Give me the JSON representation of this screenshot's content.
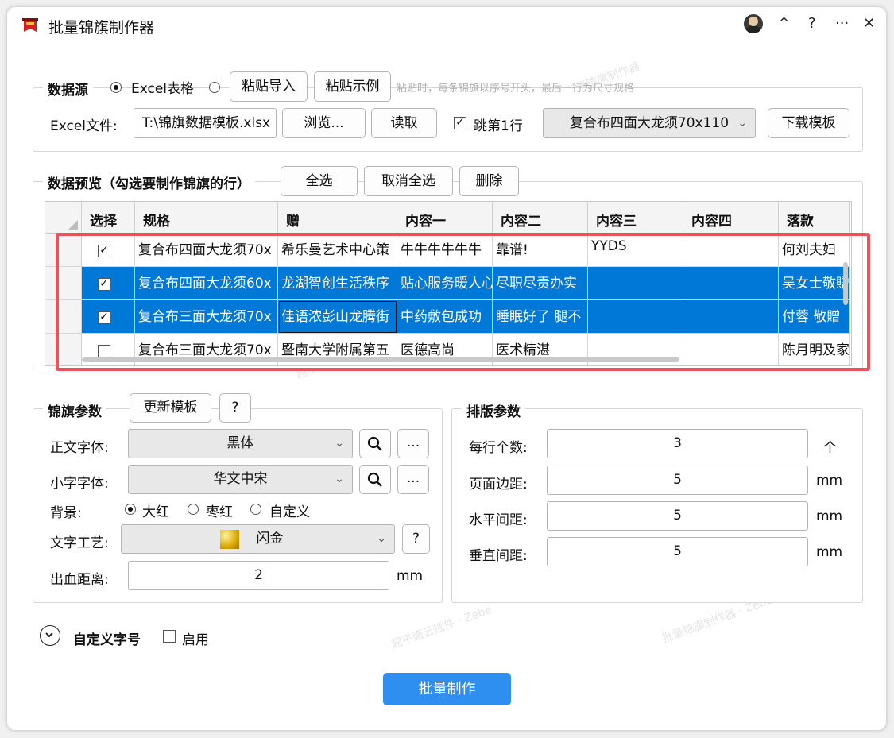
{
  "window": {
    "title": "批量锦旗制作器",
    "controls": {
      "collapse": "^",
      "help": "?",
      "more": "···",
      "close": "✕"
    }
  },
  "datasource": {
    "title": "数据源",
    "opt_excel": "Excel表格",
    "paste_import": "粘贴导入",
    "paste_example": "粘贴示例",
    "hint": "粘贴时，每条锦旗以序号开头，最后一行为尺寸规格",
    "file_label": "Excel文件:",
    "file_value": "T:\\锦旗数据模板.xlsx",
    "browse": "浏览...",
    "read": "读取",
    "skip_first": "跳第1行",
    "spec_select": "复合布四面大龙须70x110",
    "download": "下载模板"
  },
  "preview": {
    "title": "数据预览（勾选要制作锦旗的行）",
    "select_all": "全选",
    "deselect_all": "取消全选",
    "delete": "删除",
    "columns": [
      "选择",
      "规格",
      "赠",
      "内容一",
      "内容二",
      "内容三",
      "内容四",
      "落款"
    ],
    "rows": [
      {
        "checked": true,
        "selected": false,
        "cells": [
          "复合布四面大龙须70x",
          "希乐曼艺术中心策",
          "牛牛牛牛牛牛",
          "靠谱!",
          "YYDS",
          "",
          "何刘夫妇"
        ]
      },
      {
        "checked": true,
        "selected": true,
        "cells": [
          "复合布四面大龙须60x",
          "龙湖智创生活秩序",
          "贴心服务暖人心",
          "尽职尽责办实",
          "",
          "",
          "吴女士敬贈"
        ]
      },
      {
        "checked": true,
        "selected": true,
        "cells": [
          "复合布三面大龙须70x",
          "佳语浓彭山龙腾街",
          "中药敷包成功",
          "睡眠好了 腿不",
          "",
          "",
          "付蓉 敬贈"
        ]
      },
      {
        "checked": false,
        "selected": false,
        "cells": [
          "复合布三面大龙须70x",
          "暨南大学附属第五",
          "医德高尚",
          "医术精湛",
          "",
          "",
          "陈月明及家"
        ]
      }
    ]
  },
  "banner_params": {
    "title": "锦旗参数",
    "update_template": "更新模板",
    "help": "?",
    "body_font_label": "正文字体:",
    "body_font": "黑体",
    "small_font_label": "小字字体:",
    "small_font": "华文中宋",
    "more": "...",
    "bg_label": "背景:",
    "bg_options": [
      "大红",
      "枣红",
      "自定义"
    ],
    "craft_label": "文字工艺:",
    "craft": "闪金",
    "bleed_label": "出血距离:",
    "bleed": "2",
    "bleed_unit": "mm"
  },
  "layout_params": {
    "title": "排版参数",
    "per_row_label": "每行个数:",
    "per_row": "3",
    "per_row_unit": "个",
    "margin_label": "页面边距:",
    "margin": "5",
    "h_gap_label": "水平间距:",
    "h_gap": "5",
    "v_gap_label": "垂直间距:",
    "v_gap": "5",
    "unit": "mm"
  },
  "custom_size": {
    "title": "自定义字号",
    "enable": "启用"
  },
  "primary_button": "批量制作",
  "colors": {
    "accent": "#0078d7",
    "primary": "#2e8ff0",
    "highlight": "#e8545a"
  }
}
